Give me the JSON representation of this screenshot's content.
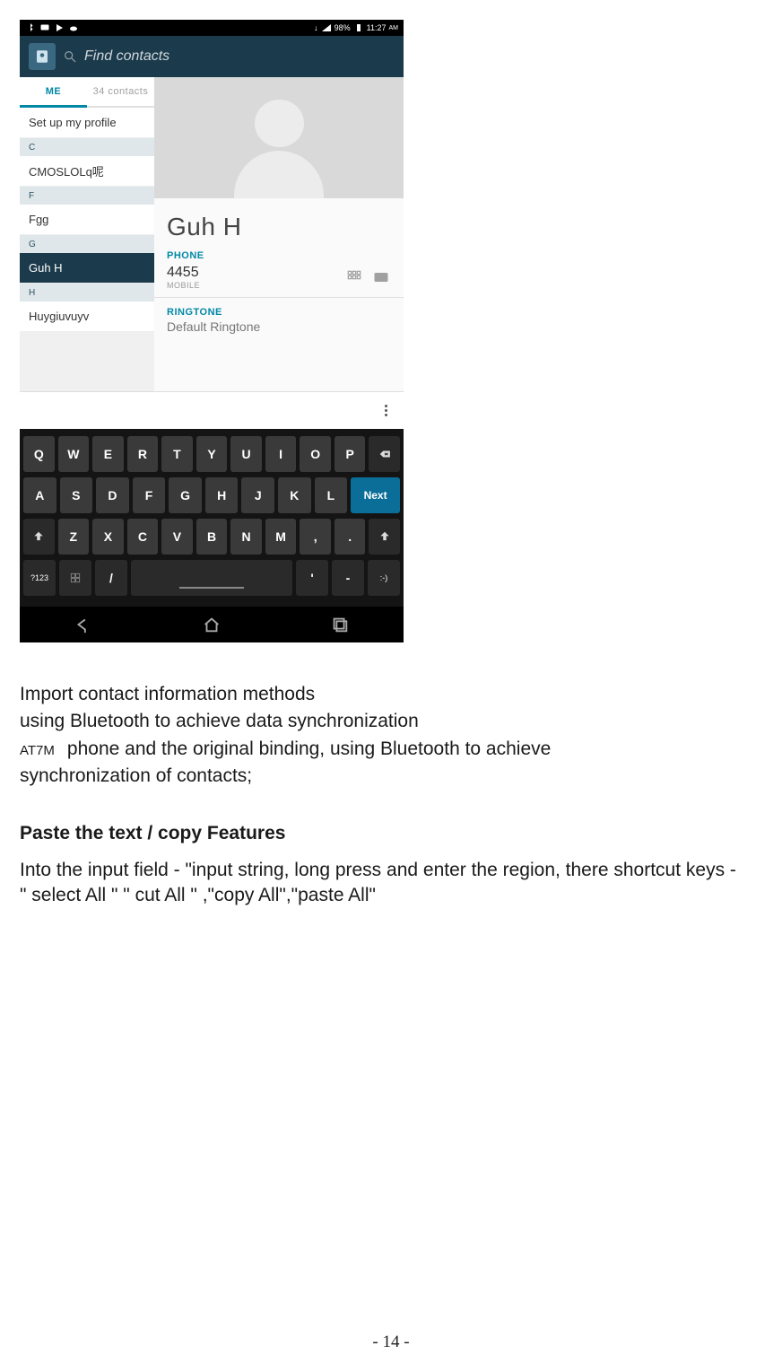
{
  "status": {
    "left_icons": [
      "bt",
      "msg",
      "play",
      "cloud"
    ],
    "right": {
      "dl": "↓",
      "signal": "▲",
      "battery_pct": "98%",
      "battery_icon": "▮",
      "time": "11:27",
      "ampm": "AM"
    }
  },
  "search": {
    "placeholder": "Find contacts"
  },
  "tabs": {
    "me": "ME",
    "all": "34 contacts"
  },
  "left_list": {
    "setup": "Set up my profile",
    "sec_c": "C",
    "item_c": "CMOSLOLq呢",
    "sec_f": "F",
    "item_f": "Fgg",
    "sec_g": "G",
    "item_g": "Guh H",
    "sec_h": "H",
    "item_h": "Huygiuvuyv"
  },
  "detail": {
    "name": "Guh H",
    "phone_label": "PHONE",
    "phone_number": "4455",
    "phone_type": "MOBILE",
    "ringtone_label": "RINGTONE",
    "ringtone_value": "Default Ringtone"
  },
  "keyboard": {
    "row1": [
      "Q",
      "W",
      "E",
      "R",
      "T",
      "Y",
      "U",
      "I",
      "O",
      "P"
    ],
    "row2": [
      "A",
      "S",
      "D",
      "F",
      "G",
      "H",
      "J",
      "K",
      "L"
    ],
    "row3": [
      "Z",
      "X",
      "C",
      "V",
      "B",
      "N",
      "M",
      ",",
      "."
    ],
    "next": "Next",
    "sym": "?123",
    "slash": "/",
    "apos": "'",
    "dash": "-",
    "smile": ":-)"
  },
  "doc": {
    "p1": "Import contact information methods",
    "p2": "using Bluetooth to achieve data synchronization",
    "model": "AT7M",
    "p3a": "phone and the original binding, using Bluetooth to achieve",
    "p3b": "synchronization of contacts;",
    "h1": "Paste the text / copy Features",
    "p4": "Into the input field - \"input string, long press and enter the region, there shortcut keys - \" select All \" \" cut All \" ,\"copy All\",\"paste All\""
  },
  "page_number": "- 14 -"
}
